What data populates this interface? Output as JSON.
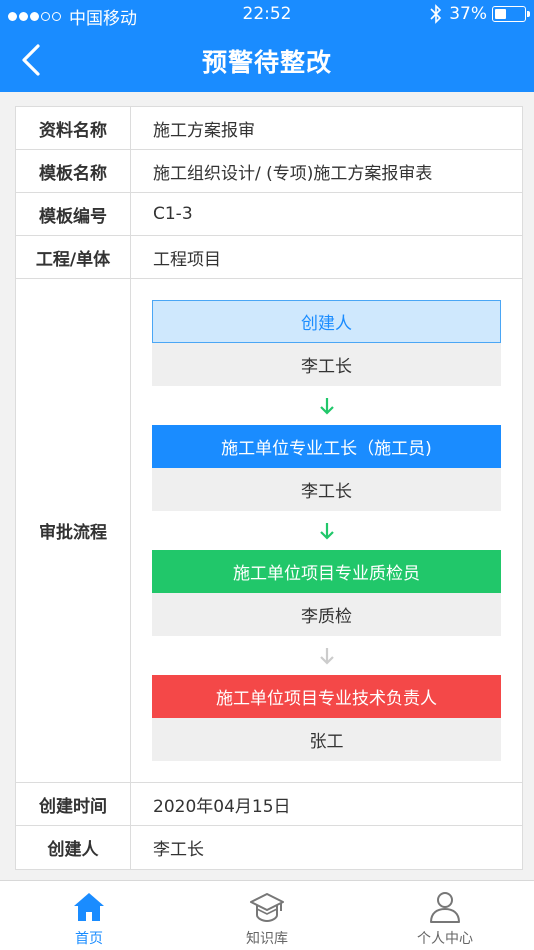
{
  "status_bar": {
    "carrier": "中国移动",
    "time": "22:52",
    "battery": "37%",
    "battery_level": 0.37
  },
  "header": {
    "title": "预警待整改"
  },
  "details": {
    "rows": [
      {
        "label": "资料名称",
        "value": "施工方案报审"
      },
      {
        "label": "模板名称",
        "value": "施工组织设计/ (专项)施工方案报审表"
      },
      {
        "label": "模板编号",
        "value": "C1-3"
      },
      {
        "label": "工程/单体",
        "value": "工程项目"
      }
    ],
    "flow_label": "审批流程",
    "flow": [
      {
        "role": "创建人",
        "name": "李工长",
        "color": "#cfe8fd"
      },
      {
        "role": "施工单位专业工长（施工员)",
        "name": "李工长",
        "color": "#1a8cff"
      },
      {
        "role": "施工单位项目专业质检员",
        "name": "李质检",
        "color": "#21c76a"
      },
      {
        "role": "施工单位项目专业技术负责人",
        "name": "张工",
        "color": "#f44848"
      }
    ],
    "arrow_colors": [
      "#21c76a",
      "#21c76a",
      "#cccccc"
    ],
    "bottom_rows": [
      {
        "label": "创建时间",
        "value": "2020年04月15日"
      },
      {
        "label": "创建人",
        "value": "李工长"
      }
    ]
  },
  "tabbar": {
    "tabs": [
      {
        "label": "首页",
        "icon": "home-icon",
        "active": true
      },
      {
        "label": "知识库",
        "icon": "graduation-cap-icon",
        "active": false
      },
      {
        "label": "个人中心",
        "icon": "person-icon",
        "active": false
      }
    ]
  },
  "colors": {
    "brand_blue": "#1a8cff",
    "success_green": "#21c76a",
    "danger_red": "#f44848"
  }
}
